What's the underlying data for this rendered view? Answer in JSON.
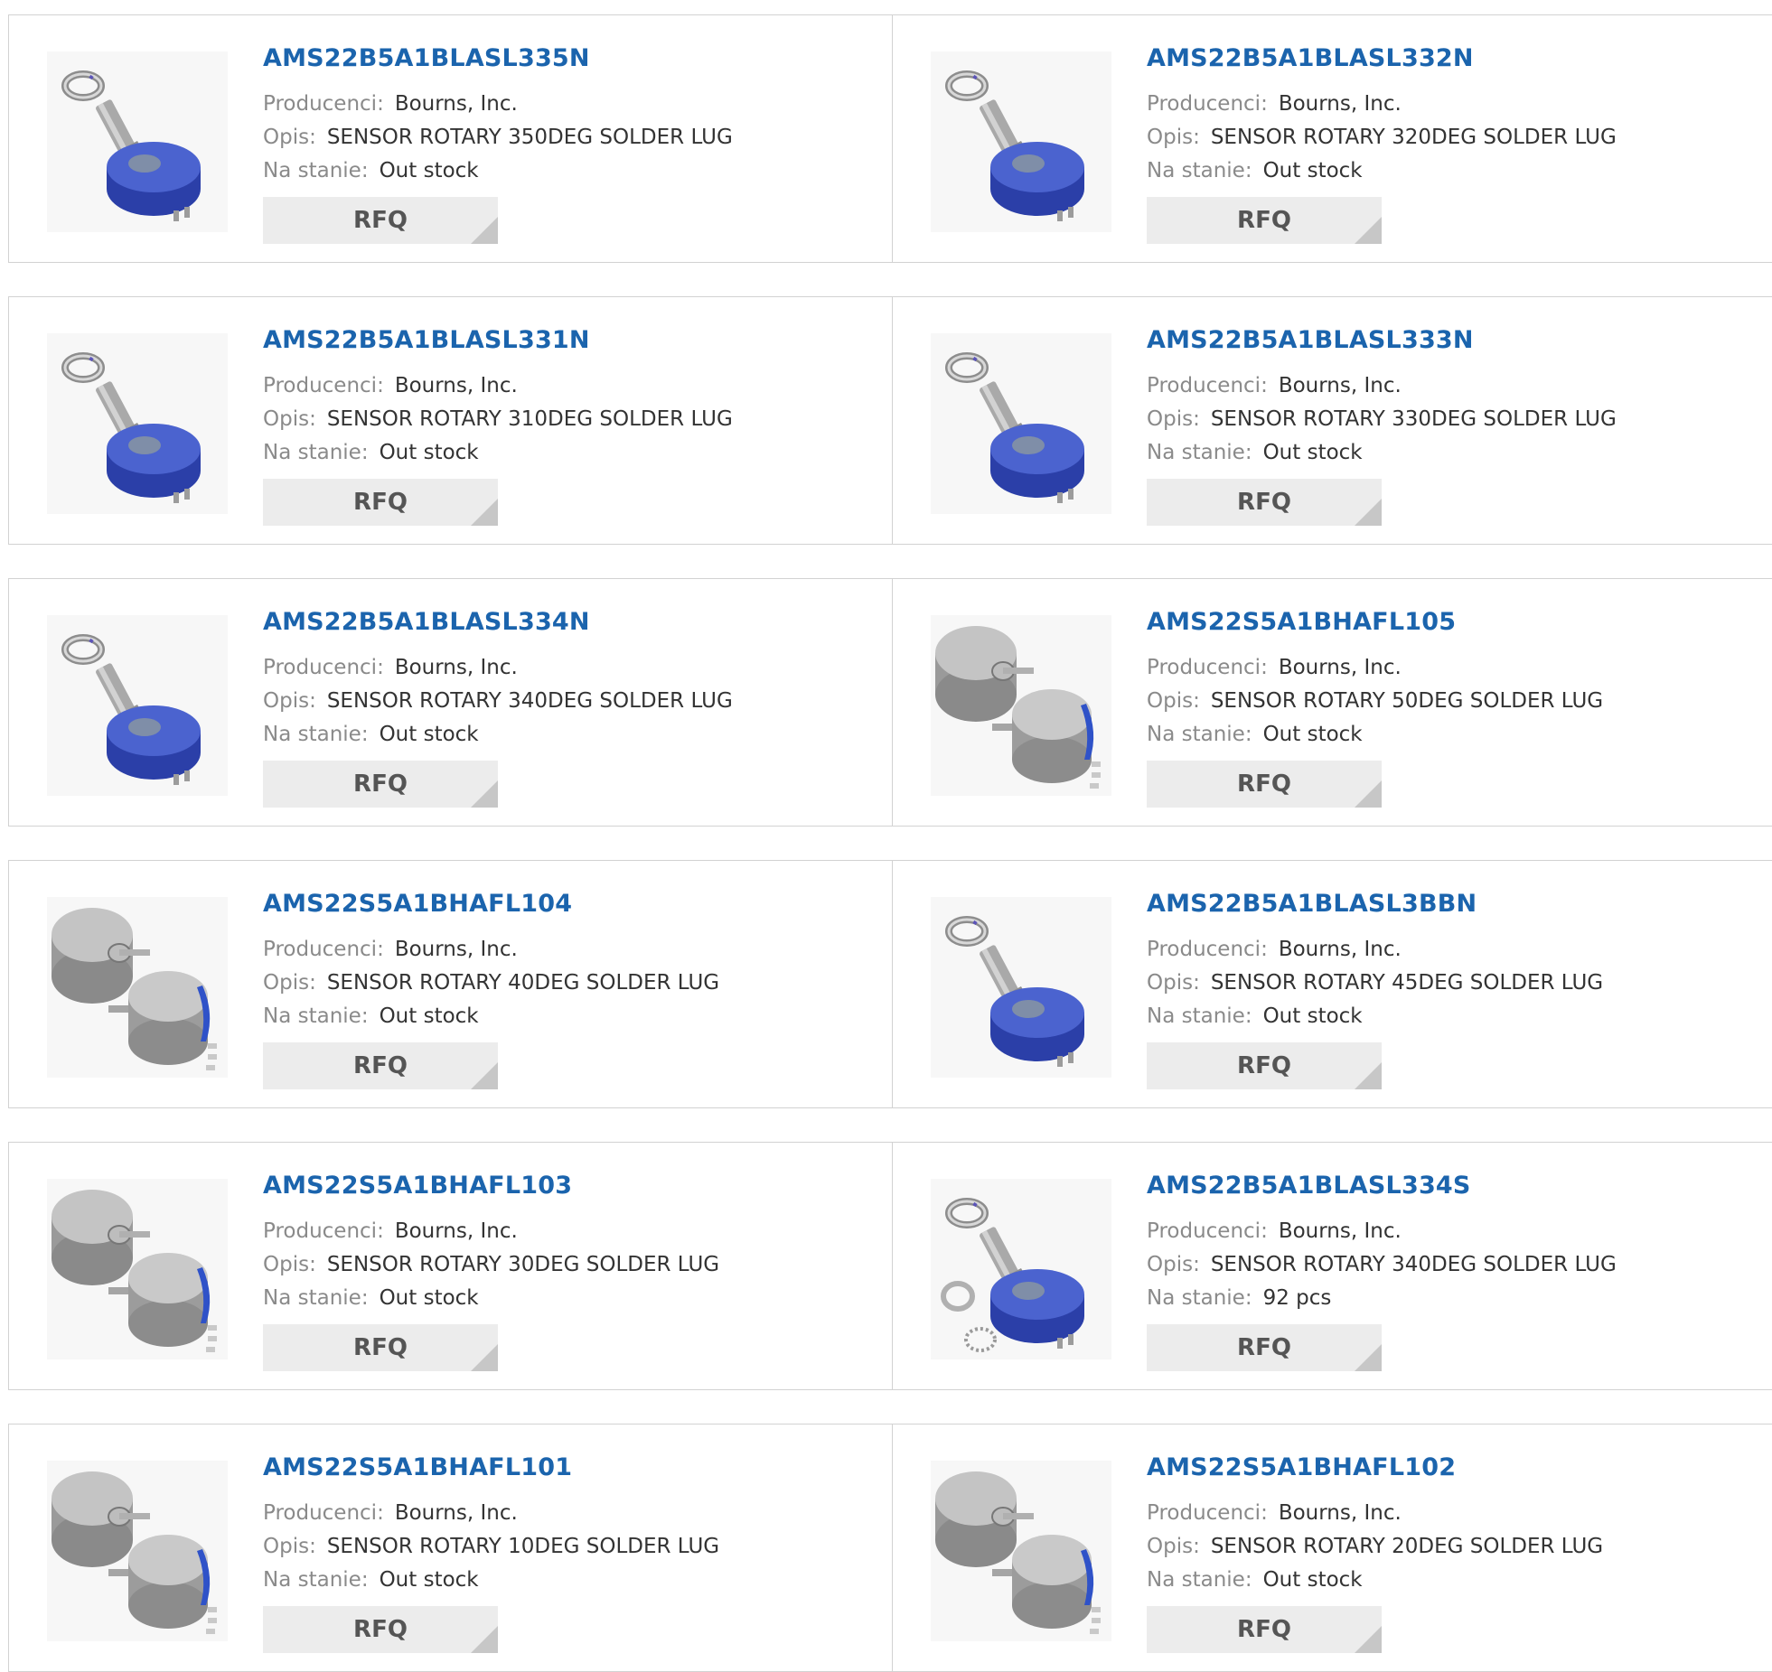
{
  "labels": {
    "manufacturer": "Producenci:",
    "description": "Opis:",
    "stock": "Na stanie:",
    "rfq": "RFQ"
  },
  "colors": {
    "part_link": "#1b64ad",
    "label": "#8a8a8a",
    "value": "#333333",
    "button_bg": "#ececec",
    "border": "#d2d2d2"
  },
  "rows": [
    [
      {
        "part": "AMS22B5A1BLASL335N",
        "manufacturer": "Bourns, Inc.",
        "description": "SENSOR ROTARY 350DEG SOLDER LUG",
        "stock": "Out stock",
        "image": "blue-potentiometer-icon"
      },
      {
        "part": "AMS22B5A1BLASL332N",
        "manufacturer": "Bourns, Inc.",
        "description": "SENSOR ROTARY 320DEG SOLDER LUG",
        "stock": "Out stock",
        "image": "blue-potentiometer-icon"
      }
    ],
    [
      {
        "part": "AMS22B5A1BLASL331N",
        "manufacturer": "Bourns, Inc.",
        "description": "SENSOR ROTARY 310DEG SOLDER LUG",
        "stock": "Out stock",
        "image": "blue-potentiometer-icon"
      },
      {
        "part": "AMS22B5A1BLASL333N",
        "manufacturer": "Bourns, Inc.",
        "description": "SENSOR ROTARY 330DEG SOLDER LUG",
        "stock": "Out stock",
        "image": "blue-potentiometer-icon"
      }
    ],
    [
      {
        "part": "AMS22B5A1BLASL334N",
        "manufacturer": "Bourns, Inc.",
        "description": "SENSOR ROTARY 340DEG SOLDER LUG",
        "stock": "Out stock",
        "image": "blue-potentiometer-icon"
      },
      {
        "part": "AMS22S5A1BHAFL105",
        "manufacturer": "Bourns, Inc.",
        "description": "SENSOR ROTARY 50DEG SOLDER LUG",
        "stock": "Out stock",
        "image": "silver-sensor-icon"
      }
    ],
    [
      {
        "part": "AMS22S5A1BHAFL104",
        "manufacturer": "Bourns, Inc.",
        "description": "SENSOR ROTARY 40DEG SOLDER LUG",
        "stock": "Out stock",
        "image": "silver-sensor-icon"
      },
      {
        "part": "AMS22B5A1BLASL3BBN",
        "manufacturer": "Bourns, Inc.",
        "description": "SENSOR ROTARY 45DEG SOLDER LUG",
        "stock": "Out stock",
        "image": "blue-potentiometer-icon"
      }
    ],
    [
      {
        "part": "AMS22S5A1BHAFL103",
        "manufacturer": "Bourns, Inc.",
        "description": "SENSOR ROTARY 30DEG SOLDER LUG",
        "stock": "Out stock",
        "image": "silver-sensor-icon"
      },
      {
        "part": "AMS22B5A1BLASL334S",
        "manufacturer": "Bourns, Inc.",
        "description": "SENSOR ROTARY 340DEG SOLDER LUG",
        "stock": "92 pcs",
        "image": "blue-potentiometer-washer-icon"
      }
    ],
    [
      {
        "part": "AMS22S5A1BHAFL101",
        "manufacturer": "Bourns, Inc.",
        "description": "SENSOR ROTARY 10DEG SOLDER LUG",
        "stock": "Out stock",
        "image": "silver-sensor-icon"
      },
      {
        "part": "AMS22S5A1BHAFL102",
        "manufacturer": "Bourns, Inc.",
        "description": "SENSOR ROTARY 20DEG SOLDER LUG",
        "stock": "Out stock",
        "image": "silver-sensor-icon"
      }
    ]
  ]
}
